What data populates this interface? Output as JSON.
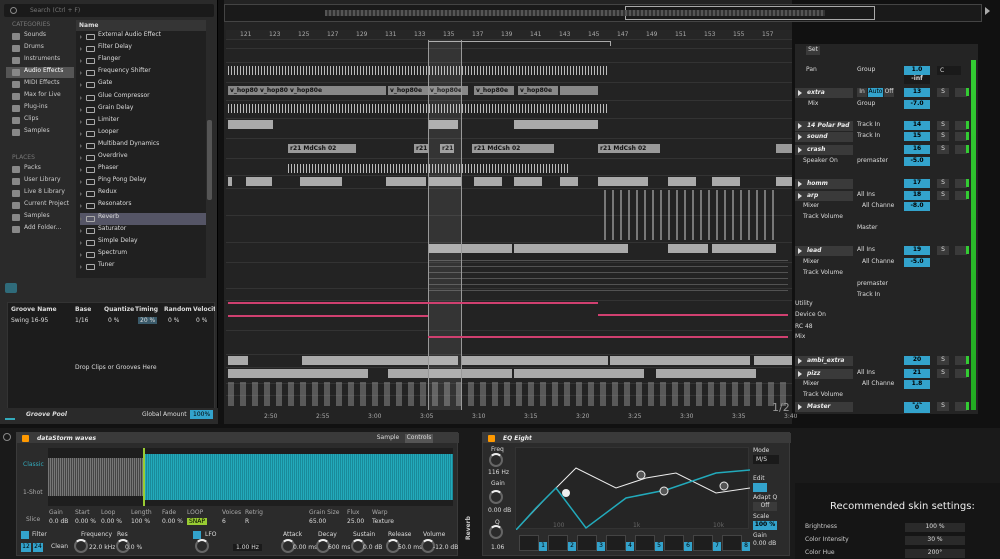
{
  "browser": {
    "search_placeholder": "Search (Ctrl + F)",
    "categories_header": "CATEGORIES",
    "categories": [
      "Sounds",
      "Drums",
      "Instruments",
      "Audio Effects",
      "MIDI Effects",
      "Max for Live",
      "Plug-ins",
      "Clips",
      "Samples"
    ],
    "places_header": "PLACES",
    "places": [
      "Packs",
      "User Library",
      "Live 8 Library",
      "Current Project",
      "Samples",
      "Add Folder..."
    ],
    "name_header": "Name",
    "items": [
      "External Audio Effect",
      "Filter Delay",
      "Flanger",
      "Frequency Shifter",
      "Gate",
      "Glue Compressor",
      "Grain Delay",
      "Limiter",
      "Looper",
      "Multiband Dynamics",
      "Overdrive",
      "Phaser",
      "Ping Pong Delay",
      "Redux",
      "Resonators",
      "Reverb",
      "Saturator",
      "Simple Delay",
      "Spectrum",
      "Tuner"
    ]
  },
  "groove": {
    "headers": [
      "Groove Name",
      "Base",
      "Quantize",
      "Timing",
      "Random",
      "Velocit"
    ],
    "row": [
      "Swing 16-95",
      "1/16",
      "0 %",
      "20 %",
      "0 %",
      "0 %"
    ],
    "drop_text": "Drop Clips or Grooves Here",
    "pool_label": "Groove Pool",
    "global_label": "Global Amount",
    "global_value": "100%"
  },
  "arrangement": {
    "ruler": [
      "121",
      "123",
      "125",
      "127",
      "129",
      "131",
      "133",
      "135",
      "137",
      "139",
      "141",
      "143",
      "145",
      "147",
      "149",
      "151",
      "153",
      "155",
      "157"
    ],
    "clips": [
      "v_hop80e",
      "v_hop80e",
      "v_hop80e",
      "v_hop80e",
      "v_hop80e",
      "v_hop80e",
      "v_hop80e",
      "v_hop80e",
      "r21 MdCsh 02",
      "r21 MdCsh 02",
      "r21",
      "r21",
      "r21 MdCsh 02",
      "r21 MdCsh 02"
    ],
    "times": [
      "2:50",
      "2:55",
      "3:00",
      "3:05",
      "3:10",
      "3:15",
      "3:20",
      "3:25",
      "3:30",
      "3:35",
      "3:40"
    ],
    "zoom": "1/2"
  },
  "mixer": {
    "set_label": "Set",
    "tracks": [
      {
        "name": "extra",
        "routing": [
          "In",
          "Auto",
          "Off"
        ],
        "num": "13"
      },
      {
        "name": "14 Polar Pad",
        "num": "14"
      },
      {
        "name": "sound",
        "num": "15"
      },
      {
        "name": "crash",
        "num": "16"
      },
      {
        "name": "homm",
        "num": "17"
      },
      {
        "name": "arp",
        "num": "18"
      },
      {
        "name": "lead",
        "num": "19"
      },
      {
        "name": "ambi_extra",
        "num": "20"
      },
      {
        "name": "pizz",
        "num": "21"
      },
      {
        "name": "Master",
        "num": "1/2"
      }
    ],
    "labels": [
      "Pan",
      "Group",
      "Mix",
      "Track In",
      "Speaker On",
      "premaster",
      "All Ins",
      "All Channe",
      "Mixer",
      "Track Volume",
      "Master",
      "Utility",
      "Device On",
      "RC 48",
      "Mix"
    ],
    "values": [
      "1.0",
      "-inf",
      "-7.0",
      "-5.0",
      "-8.0",
      "-5.0",
      "1.8",
      "0",
      "C",
      "S"
    ]
  },
  "sampler": {
    "title": "dataStorm waves",
    "tabs": [
      "Sample",
      "Controls"
    ],
    "mode": "Classic",
    "mode2": "1-Shot",
    "mode3": "Slice",
    "params": [
      "Gain",
      "Start",
      "Loop",
      "Length",
      "Fade",
      "LOOP",
      "Voices",
      "Retrig",
      "Grain Size",
      "Flux",
      "Warp"
    ],
    "values": [
      "0.0 dB",
      "0.00 %",
      "0.00 %",
      "100 %",
      "0.00 %",
      "SNAP",
      "6",
      "R",
      "65.00",
      "25.00",
      "Texture"
    ],
    "filter": "Filter",
    "freq_label": "Frequency",
    "freq": "22.0 kHz",
    "res_label": "Res",
    "res": "0.0 %",
    "lfo": "LFO",
    "lfo_rate": "1.00 Hz",
    "env": [
      "Attack",
      "Decay",
      "Sustain",
      "Release",
      "Volume"
    ],
    "env_vals": [
      "0.00 ms",
      "600 ms",
      "0.0 dB",
      "50.0 ms",
      "-12.0 dB"
    ],
    "clean": "Clean",
    "f12": "12",
    "f24": "24"
  },
  "eq": {
    "title": "EQ Eight",
    "freq_label": "Freq",
    "freq": "116 Hz",
    "gain_label": "Gain",
    "gain": "0.00 dB",
    "q_label": "Q",
    "q": "1.06",
    "mode_label": "Mode",
    "mode": "M/S",
    "edit_label": "Edit",
    "adapt_label": "Adapt Q",
    "adapt": "Off",
    "scale_label": "Scale",
    "scale": "100 %",
    "gain_out_label": "Gain",
    "gain_out": "0.00 dB",
    "reverb_label": "Reverb",
    "ticks": [
      "100",
      "1k",
      "10k"
    ],
    "bands": [
      "1",
      "2",
      "3",
      "4",
      "5",
      "6",
      "7",
      "8"
    ]
  },
  "skin": {
    "title": "Recommended skin settings:",
    "rows": [
      {
        "label": "Brightness",
        "value": "100 %"
      },
      {
        "label": "Color Intensity",
        "value": "30 %"
      },
      {
        "label": "Color Hue",
        "value": "200°"
      }
    ]
  }
}
